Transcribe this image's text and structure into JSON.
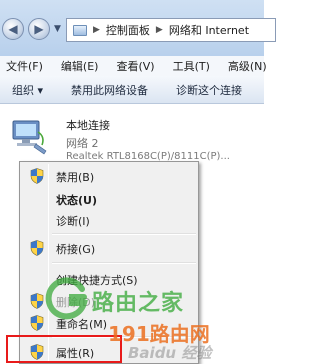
{
  "address": {
    "crumbs": [
      "控制面板",
      "网络和 Internet"
    ]
  },
  "menubar": [
    "文件(F)",
    "编辑(E)",
    "查看(V)",
    "工具(T)",
    "高级(N)"
  ],
  "toolbar": [
    "组织 ▾",
    "禁用此网络设备",
    "诊断这个连接"
  ],
  "adapter": {
    "name": "本地连接",
    "status": "网络  2",
    "device": "Realtek RTL8168C(P)/8111C(P)..."
  },
  "context_menu": {
    "items": [
      {
        "label": "禁用(B)",
        "bold": false,
        "disabled": false,
        "shield": true
      },
      {
        "label": "状态(U)",
        "bold": true,
        "disabled": false,
        "shield": false
      },
      {
        "label": "诊断(I)",
        "bold": false,
        "disabled": false,
        "shield": false
      },
      {
        "label": "桥接(G)",
        "bold": false,
        "disabled": false,
        "shield": true
      },
      {
        "label": "创建快捷方式(S)",
        "bold": false,
        "disabled": false,
        "shield": false
      },
      {
        "label": "删除(D)",
        "bold": false,
        "disabled": true,
        "shield": true
      },
      {
        "label": "重命名(M)",
        "bold": false,
        "disabled": false,
        "shield": true
      },
      {
        "label": "属性(R)",
        "bold": false,
        "disabled": false,
        "shield": true
      }
    ]
  },
  "watermarks": {
    "line1": "路由之家",
    "line2": "191路由网",
    "line3": "Baidu 经验"
  },
  "colors": {
    "highlight_box": "#e81a1a",
    "menu_background": "#f0f0f0",
    "toolbar_gradient_top": "#f5f8fc"
  }
}
